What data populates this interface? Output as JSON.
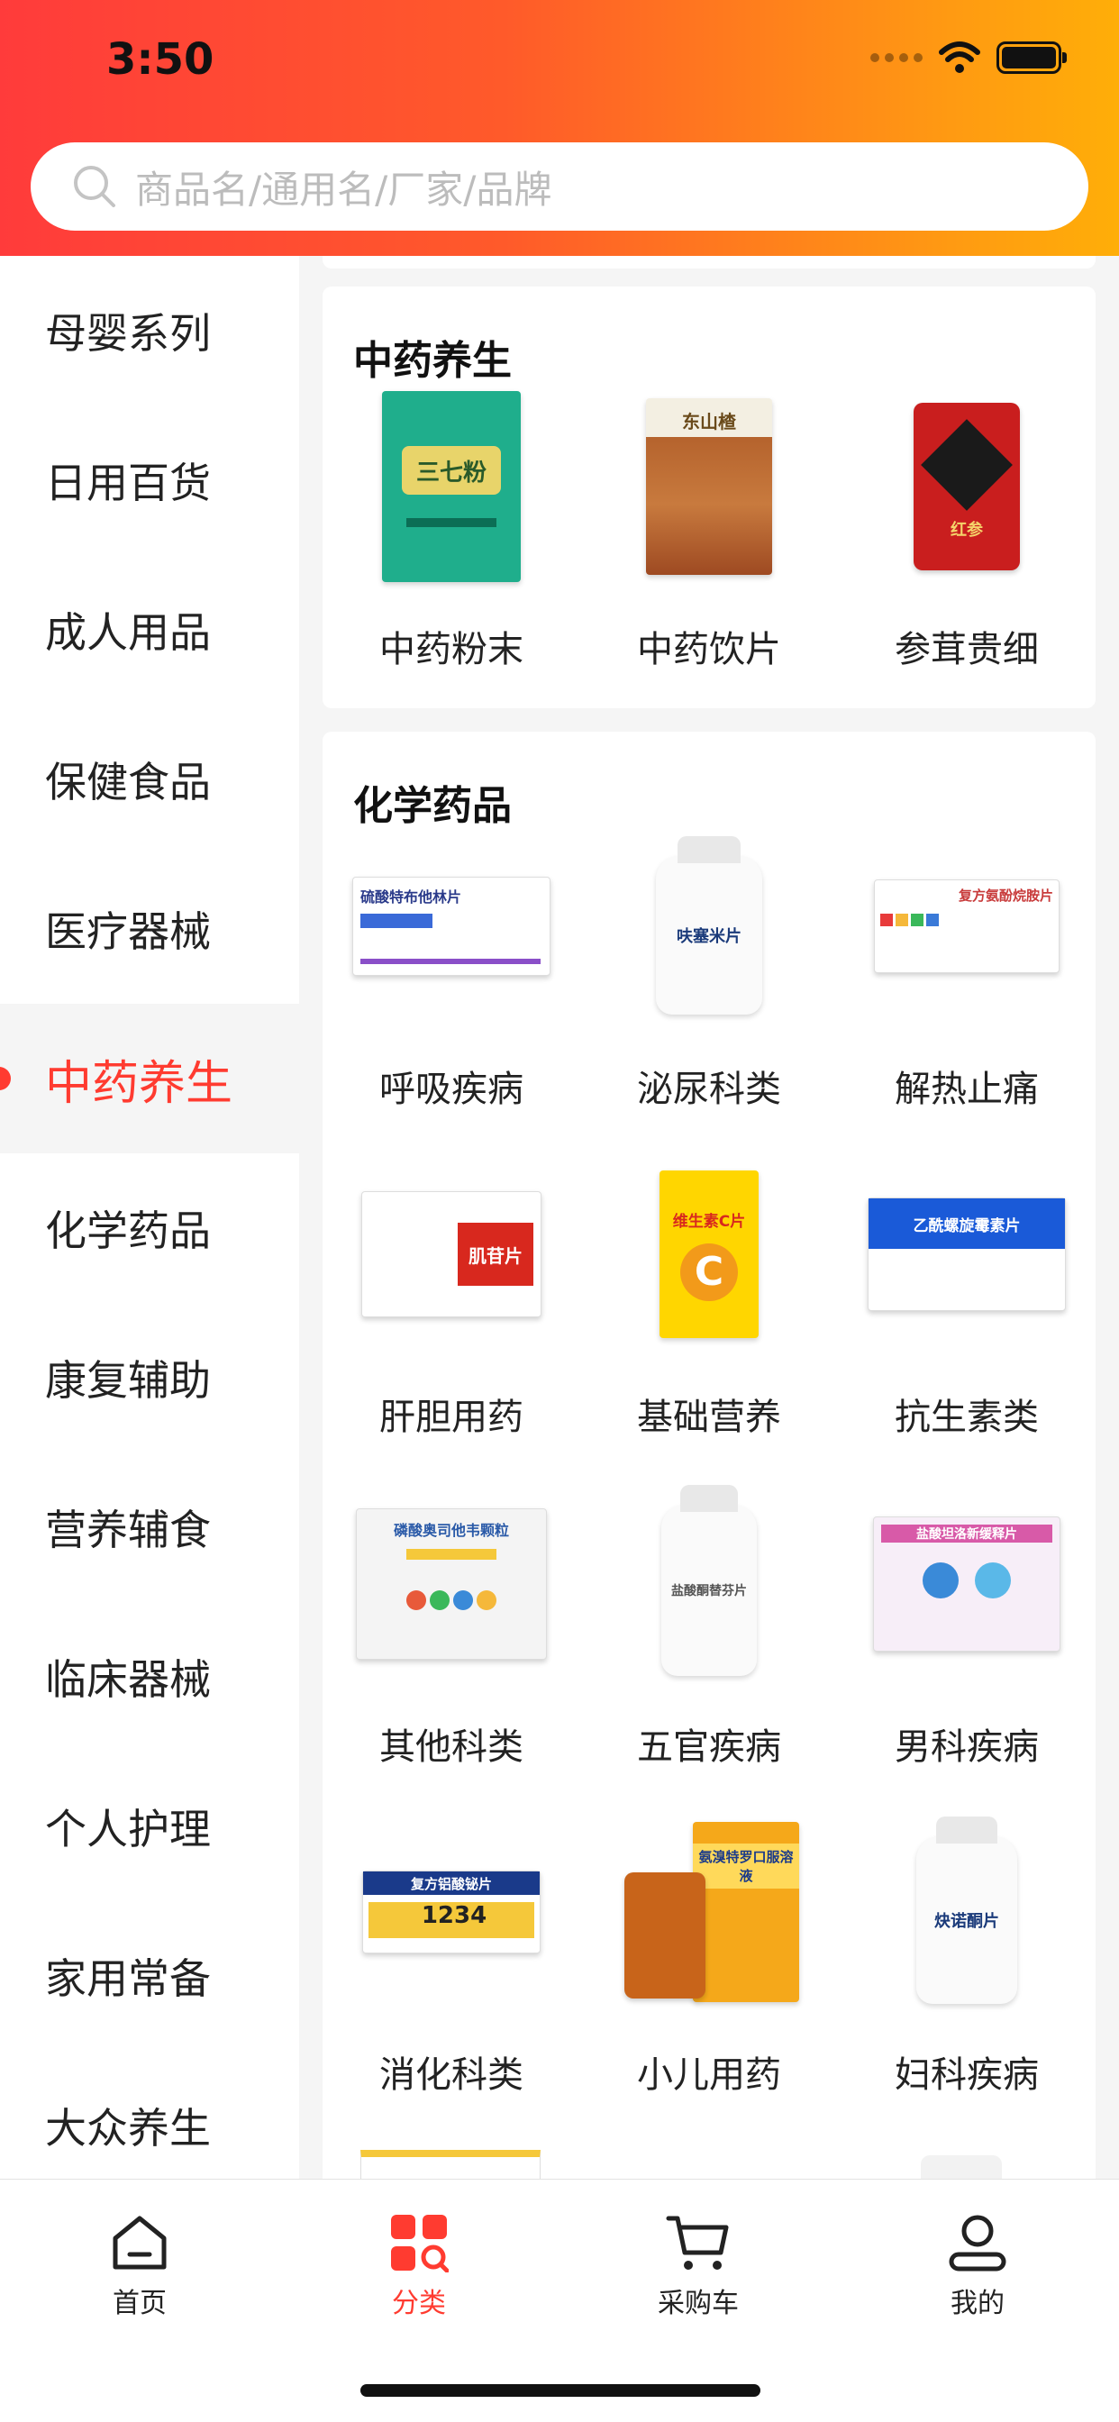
{
  "status_bar": {
    "time": "3:50"
  },
  "search": {
    "placeholder": "商品名/通用名/厂家/品牌"
  },
  "sidebar": {
    "items": [
      {
        "label": "母婴系列"
      },
      {
        "label": "日用百货"
      },
      {
        "label": "成人用品"
      },
      {
        "label": "保健食品"
      },
      {
        "label": "医疗器械"
      },
      {
        "label": "中药养生",
        "active": true
      },
      {
        "label": "化学药品"
      },
      {
        "label": "康复辅助"
      },
      {
        "label": "营养辅食"
      },
      {
        "label": "临床器械"
      },
      {
        "label": "个人护理"
      },
      {
        "label": "家用常备"
      },
      {
        "label": "大众养生"
      }
    ]
  },
  "sections": [
    {
      "title": "中药养生",
      "items": [
        {
          "label": "中药粉末",
          "product_text": "三七粉"
        },
        {
          "label": "中药饮片",
          "product_text": "东山楂"
        },
        {
          "label": "参茸贵细",
          "product_text": "红参"
        }
      ]
    },
    {
      "title": "化学药品",
      "items": [
        {
          "label": "呼吸疾病",
          "product_text": "硫酸特布他林片"
        },
        {
          "label": "泌尿科类",
          "product_text": "呋塞米片"
        },
        {
          "label": "解热止痛",
          "product_text": "复方氨酚烷胺片"
        },
        {
          "label": "肝胆用药",
          "product_text": "肌苷片"
        },
        {
          "label": "基础营养",
          "product_text": "维生素C片"
        },
        {
          "label": "抗生素类",
          "product_text": "乙酰螺旋霉素片"
        },
        {
          "label": "其他科类",
          "product_text": "磷酸奥司他韦颗粒"
        },
        {
          "label": "五官疾病",
          "product_text": "盐酸酮替芬片"
        },
        {
          "label": "男科疾病",
          "product_text": "盐酸坦洛新缓释片"
        },
        {
          "label": "消化科类",
          "product_text": "复方铝酸铋片"
        },
        {
          "label": "小儿用药",
          "product_text": "氨溴特罗口服溶液"
        },
        {
          "label": "妇科疾病",
          "product_text": "炔诺酮片"
        }
      ]
    }
  ],
  "tabbar": {
    "tabs": [
      {
        "label": "首页",
        "icon": "home-icon"
      },
      {
        "label": "分类",
        "icon": "category-icon",
        "active": true
      },
      {
        "label": "采购车",
        "icon": "cart-icon"
      },
      {
        "label": "我的",
        "icon": "profile-icon"
      }
    ]
  },
  "colors": {
    "accent": "#ff3b30",
    "header_start": "#ff3b3b",
    "header_end": "#ffae08"
  }
}
